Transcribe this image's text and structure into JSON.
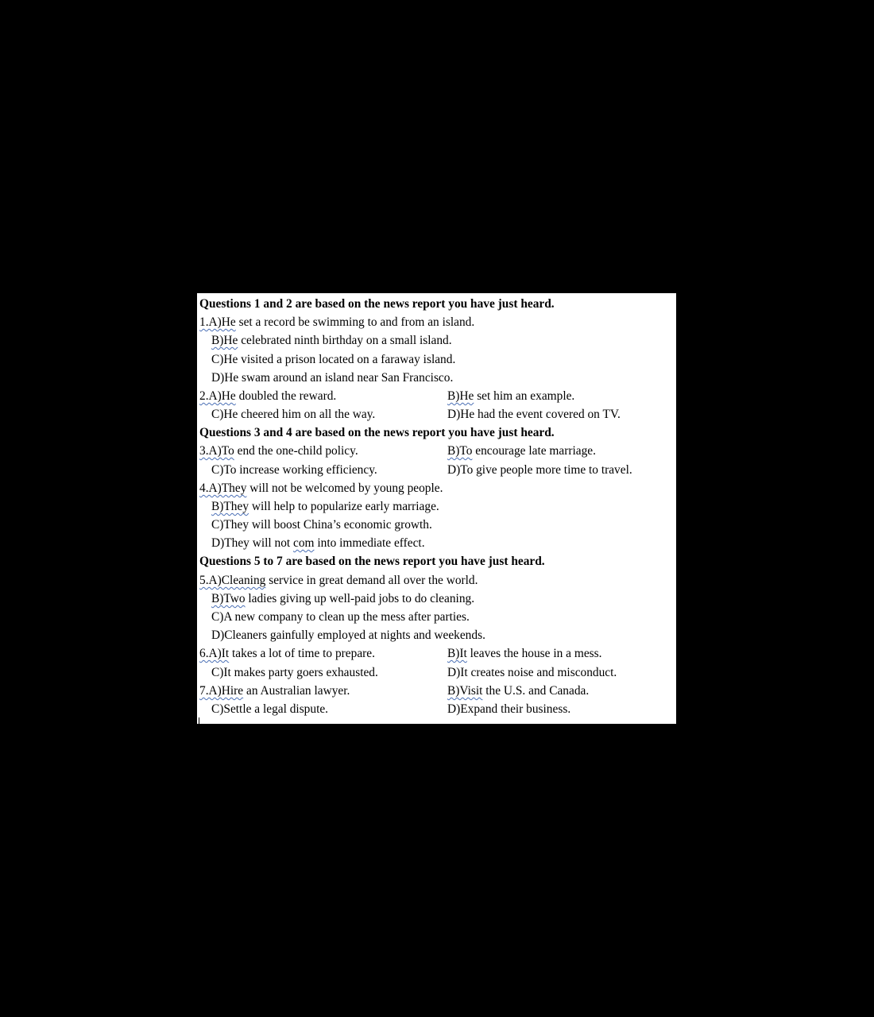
{
  "sections": [
    {
      "heading": "Questions 1 and 2 are based on the news report you have just heard."
    },
    {
      "heading": "Questions 3 and 4 are based on the news report you have just heard."
    },
    {
      "heading": "Questions 5 to 7 are based on the news report you have just heard."
    }
  ],
  "q1": {
    "a_mark": "1.A)He",
    "a_rest": " set a record be swimming to and from an island.",
    "b_mark": "B)He",
    "b_rest": " celebrated ninth birthday on a small island.",
    "c": "C)He visited a prison located on a faraway island.",
    "d": "D)He swam around an island near San Francisco."
  },
  "q2": {
    "a_mark": "2.A)He",
    "a_rest": " doubled the reward.",
    "b_mark": "B)He",
    "b_rest": " set him an example.",
    "c": "C)He cheered him on all the way.",
    "d": "D)He had the event covered on TV."
  },
  "q3": {
    "a_mark": "3.A)To",
    "a_rest": " end the one-child policy.",
    "b_mark": "B)To",
    "b_rest": " encourage late marriage.",
    "c": "C)To increase working efficiency.",
    "d": "D)To give people more time to travel."
  },
  "q4": {
    "a_mark": "4.A)They",
    "a_rest": " will not be welcomed by young people.",
    "b_mark": "B)They",
    "b_rest": " will help to popularize early marriage.",
    "c": "C)They will boost China’s economic growth.",
    "d_pre": "D)They will not ",
    "d_mark": "com",
    "d_post": " into immediate effect."
  },
  "q5": {
    "a_mark": "5.A)Cleaning",
    "a_rest": " service in great demand all over the world.",
    "b_mark": "B)Two",
    "b_rest": " ladies giving up well-paid jobs to do cleaning.",
    "c": "C)A new company to clean up the mess after parties.",
    "d": "D)Cleaners gainfully employed at nights and weekends."
  },
  "q6": {
    "a_mark": "6.A)It",
    "a_rest": " takes a lot of time to prepare.",
    "b_mark": "B)It",
    "b_rest": " leaves the house in a mess.",
    "c": "C)It makes party goers exhausted.",
    "d": "D)It creates noise and misconduct."
  },
  "q7": {
    "a_mark": "7.A)Hire",
    "a_rest": " an Australian lawyer.",
    "b_mark": "B)Visit",
    "b_rest": " the U.S. and Canada.",
    "c": "C)Settle a legal dispute.",
    "d": "D)Expand their business."
  },
  "colors": {
    "background": "#000000",
    "page": "#ffffff",
    "spellcheck_underline": "#4a6fb5"
  }
}
